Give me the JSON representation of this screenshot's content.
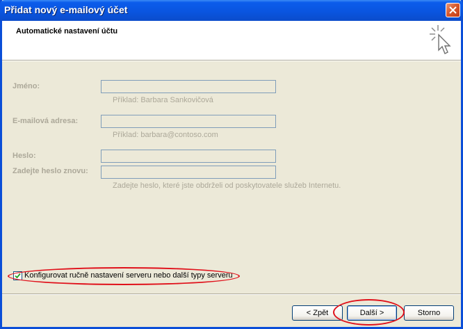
{
  "window": {
    "title": "Přidat nový e-mailový účet"
  },
  "header": {
    "title": "Automatické nastavení účtu",
    "icon": "wizard-cursor-icon"
  },
  "form": {
    "name": {
      "label": "Jméno:",
      "value": "",
      "hint": "Příklad: Barbara Sankovičová"
    },
    "email": {
      "label": "E-mailová adresa:",
      "value": "",
      "hint": "Příklad: barbara@contoso.com"
    },
    "password": {
      "label": "Heslo:",
      "value": ""
    },
    "password_confirm": {
      "label": "Zadejte heslo znovu:",
      "value": "",
      "hint": "Zadejte heslo, které jste obdrželi od poskytovatele služeb Internetu."
    },
    "disabled": true
  },
  "manual": {
    "label": "Konfigurovat ručně nastavení serveru nebo další typy serveru",
    "checked": true
  },
  "buttons": {
    "back": "< Zpět",
    "next": "Další >",
    "cancel": "Storno"
  },
  "colors": {
    "annotation": "#E0101A",
    "titlebar": "#0A55E0",
    "disabled_text": "#ACA899"
  }
}
